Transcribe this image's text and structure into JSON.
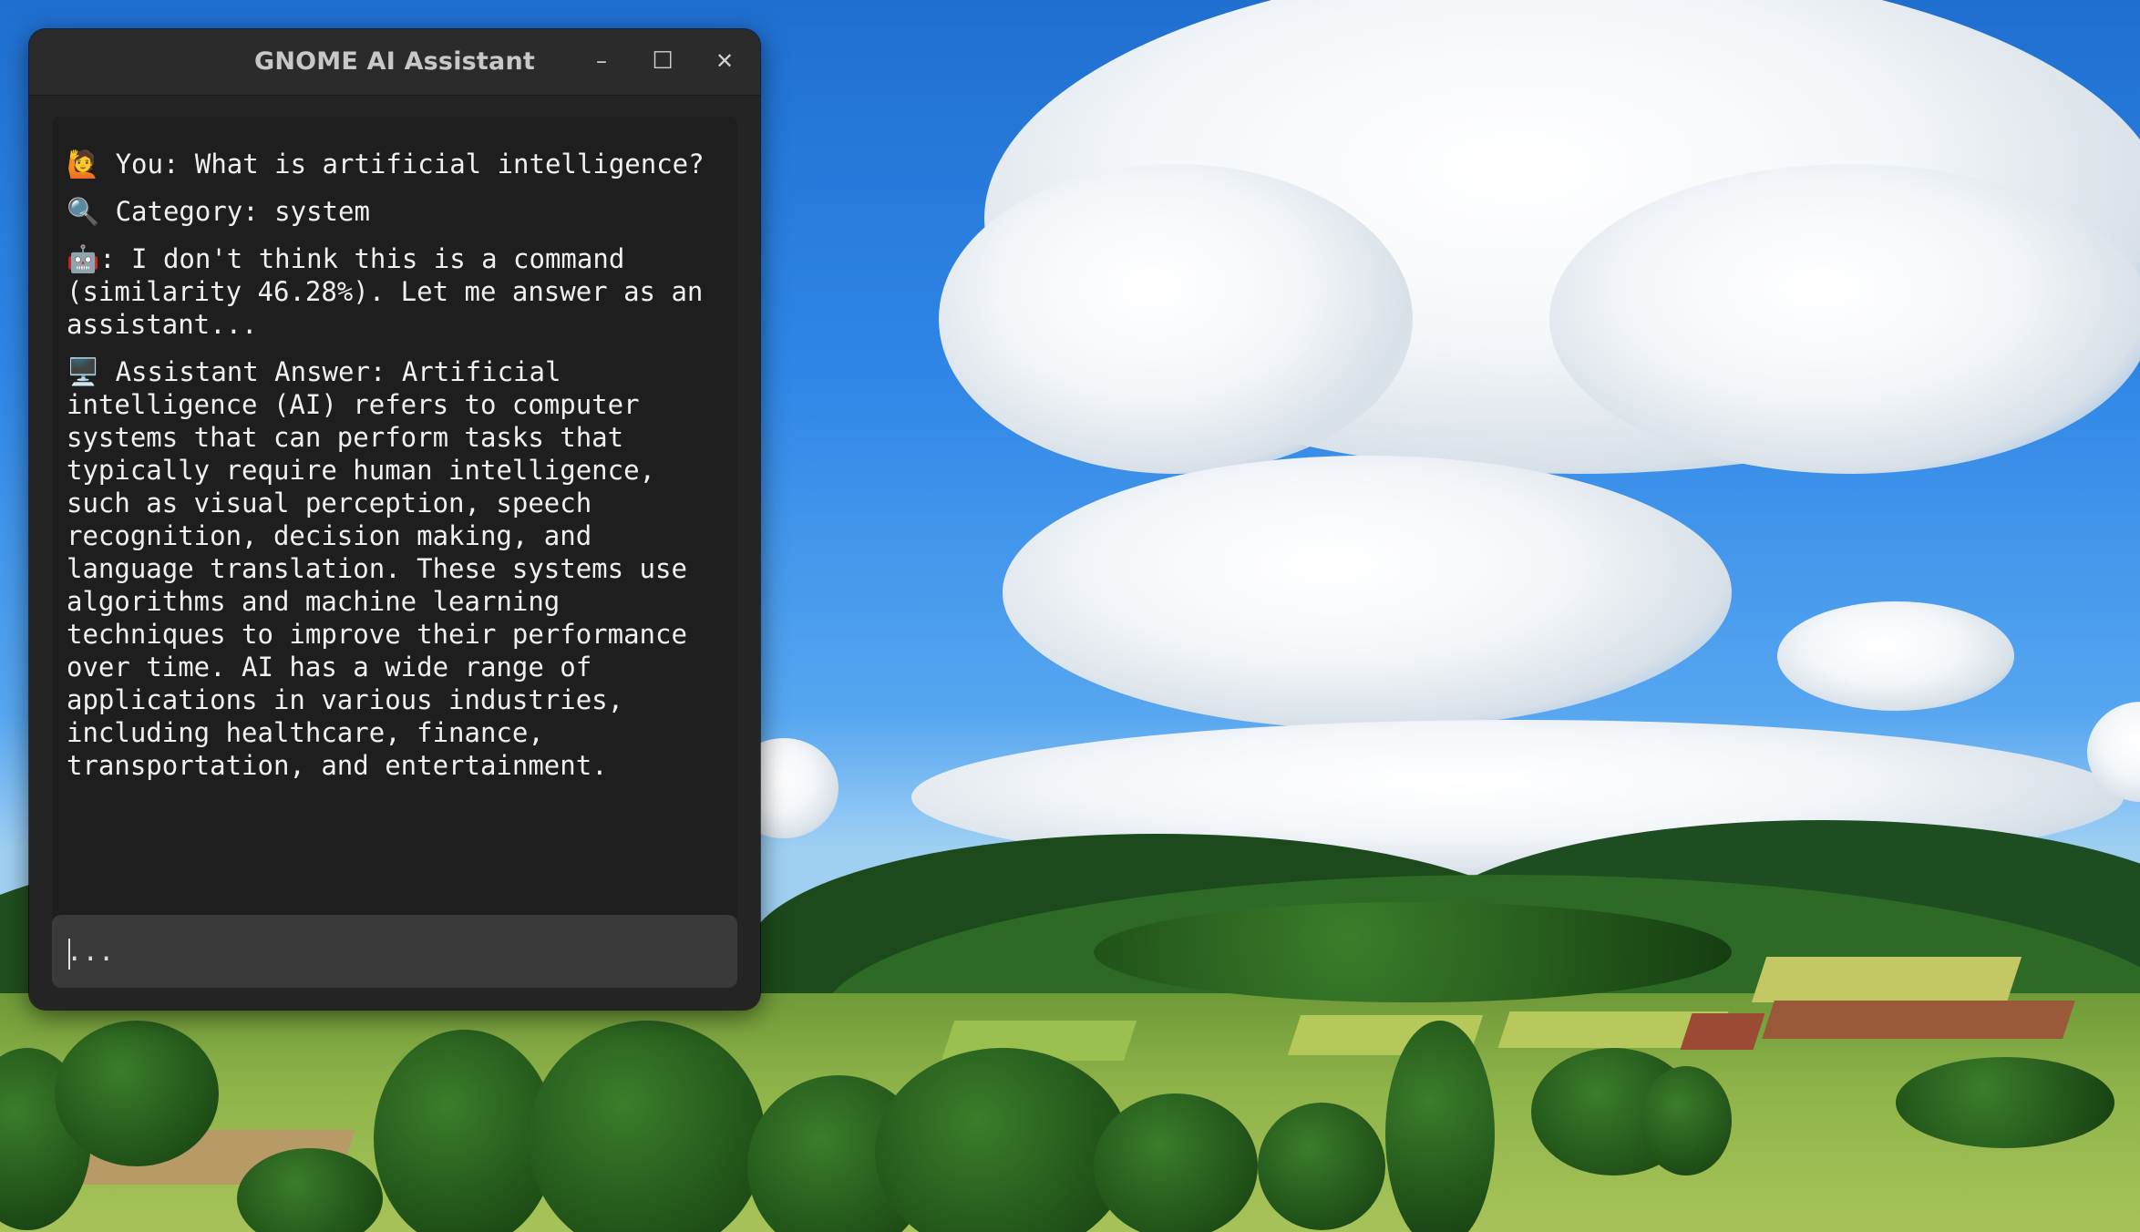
{
  "window": {
    "title": "GNOME AI Assistant",
    "minimize_icon": "minimize-icon",
    "maximize_icon": "maximize-icon",
    "close_icon": "close-icon",
    "minimize_glyph": "–",
    "maximize_glyph": "☐",
    "close_glyph": "✕"
  },
  "chat": {
    "messages": [
      {
        "icon": "🙋",
        "icon_name": "person-raising-hand-icon",
        "text": " You: What is artificial intelligence?"
      },
      {
        "icon": "🔍",
        "icon_name": "magnifier-icon",
        "text": " Category: system"
      },
      {
        "icon": "🤖",
        "icon_name": "robot-icon",
        "text": ": I don't think this is a command (similarity 46.28%). Let me answer as an assistant..."
      },
      {
        "icon": "🖥️",
        "icon_name": "desktop-computer-icon",
        "text": " Assistant Answer: Artificial intelligence (AI) refers to computer systems that can perform tasks that typically require human intelligence, such as visual perception, speech recognition, decision making, and language translation. These systems use algorithms and machine learning techniques to improve their performance over time. AI has a wide range of applications in various industries, including healthcare, finance, transportation, and entertainment."
      }
    ]
  },
  "input": {
    "value": "",
    "placeholder": "..."
  },
  "colors": {
    "window_bg": "#242424",
    "titlebar_bg": "#2b2b2b",
    "chat_bg": "#1e1e1e",
    "input_bg": "#3a3a3a",
    "text": "#f0f0f0"
  }
}
